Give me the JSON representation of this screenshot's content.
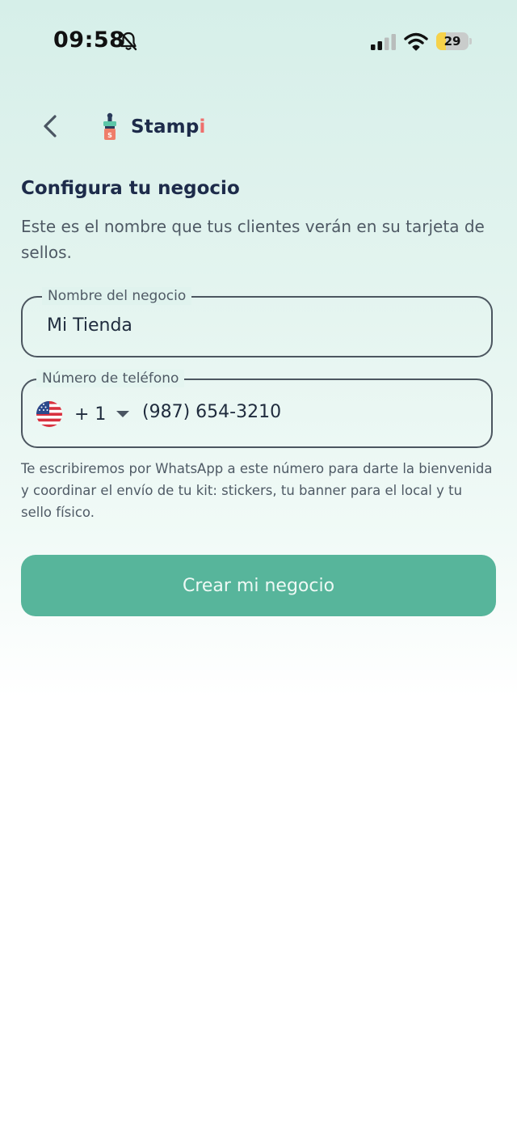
{
  "status_bar": {
    "time": "09:58",
    "battery_level": "29",
    "battery_fraction": 0.29,
    "icons": [
      "bell-slash-icon",
      "cellular-signal-icon",
      "wifi-icon",
      "battery-charging-icon"
    ]
  },
  "header": {
    "back_icon": "chevron-left-icon",
    "brand_name": "Stamp",
    "brand_accent": "i"
  },
  "page": {
    "title": "Configura tu negocio",
    "subtitle": "Este es el nombre que tus clientes verán en su tarjeta de sellos."
  },
  "form": {
    "business_name": {
      "label": "Nombre del negocio",
      "value": "Mi Tienda"
    },
    "phone": {
      "label": "Número de teléfono",
      "country_flag": "us-flag-icon",
      "dial_code": "+ 1",
      "value": "(987) 654-3210"
    },
    "helper_text": "Te escribiremos por WhatsApp a este número para darte la bienvenida y coordinar el envío de tu kit: stickers, tu banner para el local y tu sello físico.",
    "submit_label": "Crear mi negocio"
  },
  "colors": {
    "primary_button": "#57b59b",
    "title_text": "#1d2b4a",
    "brand_accent": "#ef6f6c",
    "background_top": "#d6efe9"
  }
}
